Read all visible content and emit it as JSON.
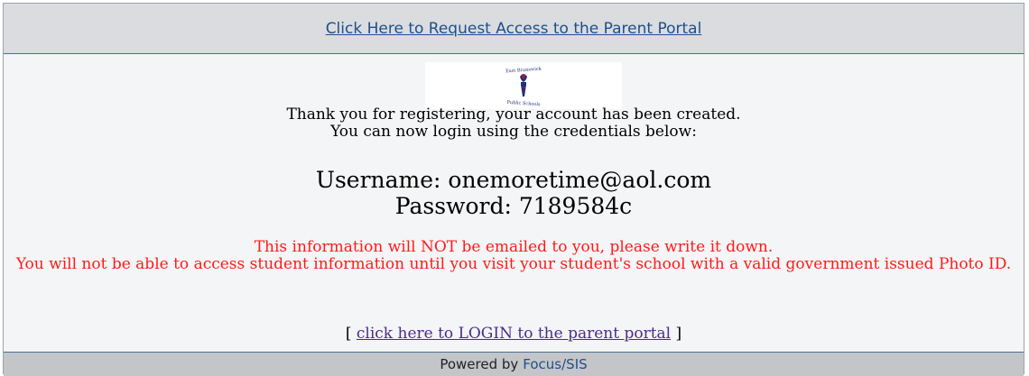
{
  "header": {
    "request_access_link": "Click Here to Request Access to the Parent Portal"
  },
  "logo": {
    "icon": "school-torch-logo",
    "top_text": "East Brunswick",
    "bottom_text": "Public Schools"
  },
  "message": {
    "line1": "Thank you for registering, your account has been created.",
    "line2": "You can now login using the credentials below:"
  },
  "credentials": {
    "username_line": "Username: onemoretime@aol.com",
    "password_line": "Password: 7189584c"
  },
  "warning": {
    "line1": "This information will NOT be emailed to you, please write it down.",
    "line2": "You will not be able to access student information until you visit your student's school with a valid government issued Photo ID.",
    "color": "#ff1a1a"
  },
  "login": {
    "open_bracket": "[",
    "link": "click here to LOGIN to the parent portal",
    "close_bracket": "]"
  },
  "footer": {
    "powered_by": "Powered by",
    "product_link": "Focus/SIS"
  }
}
